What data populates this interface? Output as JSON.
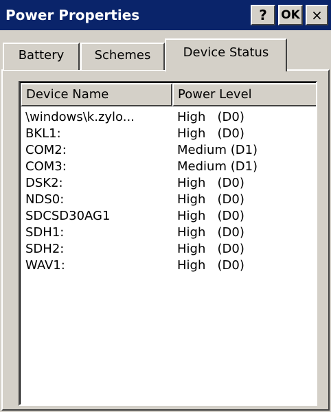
{
  "window": {
    "title": "Power Properties",
    "buttons": {
      "help": "?",
      "ok": "OK",
      "close": "×"
    }
  },
  "tabs": [
    {
      "label": "Battery",
      "active": false
    },
    {
      "label": "Schemes",
      "active": false
    },
    {
      "label": "Device Status",
      "active": true
    }
  ],
  "device_list": {
    "columns": [
      "Device Name",
      "Power Level"
    ],
    "rows": [
      {
        "name": "\\windows\\k.zylo...",
        "level": "High   (D0)"
      },
      {
        "name": "BKL1:",
        "level": "High   (D0)"
      },
      {
        "name": "COM2:",
        "level": "Medium (D1)"
      },
      {
        "name": "COM3:",
        "level": "Medium (D1)"
      },
      {
        "name": "DSK2:",
        "level": "High   (D0)"
      },
      {
        "name": "NDS0:",
        "level": "High   (D0)"
      },
      {
        "name": "SDCSD30AG1",
        "level": "High   (D0)"
      },
      {
        "name": "SDH1:",
        "level": "High   (D0)"
      },
      {
        "name": "SDH2:",
        "level": "High   (D0)"
      },
      {
        "name": "WAV1:",
        "level": "High   (D0)"
      }
    ]
  },
  "colors": {
    "titlebar": "#0a246a",
    "face": "#d4d0c8",
    "list_background": "#ffffff"
  }
}
